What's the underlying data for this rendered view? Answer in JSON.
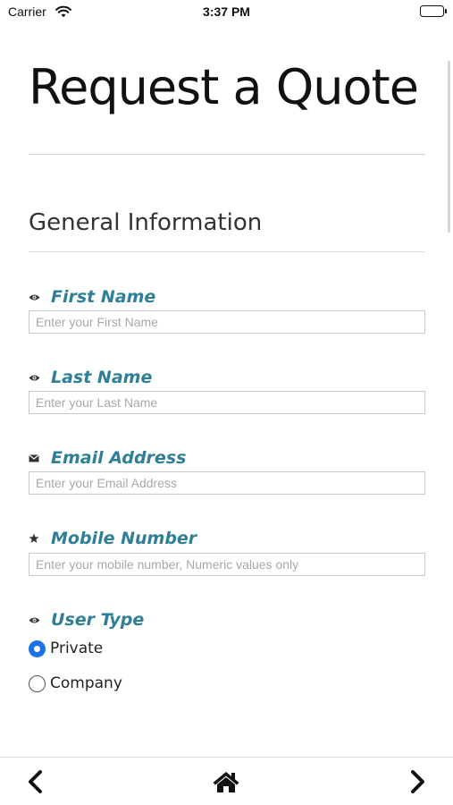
{
  "status_bar": {
    "carrier": "Carrier",
    "time": "3:37 PM"
  },
  "page": {
    "title": "Request a Quote",
    "section_title": "General Information"
  },
  "fields": [
    {
      "label": "First Name",
      "placeholder": "Enter your First Name",
      "value": "",
      "icon": "eye-icon"
    },
    {
      "label": "Last Name",
      "placeholder": "Enter your Last Name",
      "value": "",
      "icon": "eye-icon"
    },
    {
      "label": "Email Address",
      "placeholder": "Enter your Email Address",
      "value": "",
      "icon": "envelope-icon"
    },
    {
      "label": "Mobile Number",
      "placeholder": "Enter your mobile number, Numeric values only",
      "value": "",
      "icon": "star-icon"
    }
  ],
  "user_type": {
    "label": "User Type",
    "icon": "eye-icon",
    "options": [
      {
        "label": "Private",
        "selected": true
      },
      {
        "label": "Company",
        "selected": false
      }
    ]
  },
  "toolbar": {
    "back": "chevron-left-icon",
    "home": "home-icon",
    "forward": "chevron-right-icon"
  },
  "colors": {
    "label": "#2e7f97",
    "radio_selected": "#1a73e8"
  }
}
